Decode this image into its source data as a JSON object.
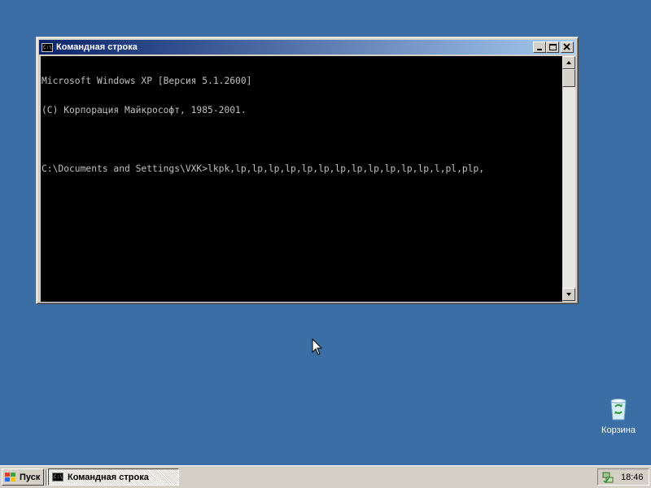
{
  "window": {
    "title": "Командная строка",
    "icon_name": "console-icon",
    "icon_text": "C:\\"
  },
  "console": {
    "lines": [
      "Microsoft Windows XP [Версия 5.1.2600]",
      "(С) Корпорация Майкрософт, 1985-2001.",
      "",
      "C:\\Documents and Settings\\VXK>lkpk,lp,lp,lp,lp,lp,lp,lp,lp,lp,lp,lp,lp,l,pl,plp,"
    ]
  },
  "desktop": {
    "recycle_bin_label": "Корзина",
    "background_color": "#3a6ea5"
  },
  "taskbar": {
    "start_label": "Пуск",
    "task_button_label": "Командная строка",
    "clock": "18:46"
  },
  "colors": {
    "titlebar_start": "#0a246a",
    "titlebar_end": "#a6caf0",
    "console_bg": "#000000",
    "console_fg": "#c0c0c0"
  }
}
